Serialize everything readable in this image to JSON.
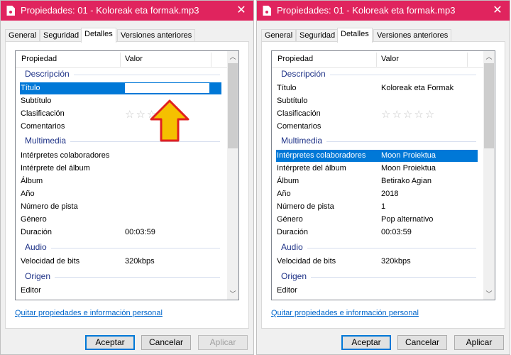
{
  "colors": {
    "titlebar": "#e0245e",
    "selection": "#0078d7",
    "group": "#1e3287",
    "link": "#0066cc",
    "arrow_fill": "#f5c000",
    "arrow_stroke": "#e02020"
  },
  "left": {
    "title": "Propiedades: 01 - Koloreak eta formak.mp3",
    "tabs": [
      "General",
      "Seguridad",
      "Detalles",
      "Versiones anteriores"
    ],
    "header": {
      "property": "Propiedad",
      "value": "Valor"
    },
    "groups": {
      "description": "Descripción",
      "multimedia": "Multimedia",
      "audio": "Audio",
      "origin": "Origen"
    },
    "rows": {
      "title": "Título",
      "subtitle": "Subtítulo",
      "rating": "Clasificación",
      "comments": "Comentarios",
      "contrib": "Intérpretes colaboradores",
      "album_artist": "Intérprete del álbum",
      "album": "Álbum",
      "year": "Año",
      "track": "Número de pista",
      "genre": "Género",
      "duration": "Duración",
      "duration_value": "00:03:59",
      "bitrate": "Velocidad de bits",
      "bitrate_value": "320kbps",
      "editor": "Editor"
    },
    "stars": "☆☆☆☆☆",
    "link": "Quitar propiedades e información personal",
    "buttons": {
      "ok": "Aceptar",
      "cancel": "Cancelar",
      "apply": "Aplicar"
    }
  },
  "right": {
    "title": "Propiedades: 01 - Koloreak eta formak.mp3",
    "tabs": [
      "General",
      "Seguridad",
      "Detalles",
      "Versiones anteriores"
    ],
    "header": {
      "property": "Propiedad",
      "value": "Valor"
    },
    "groups": {
      "description": "Descripción",
      "multimedia": "Multimedia",
      "audio": "Audio",
      "origin": "Origen"
    },
    "rows": {
      "title": "Título",
      "title_value": "Koloreak eta Formak",
      "subtitle": "Subtítulo",
      "rating": "Clasificación",
      "comments": "Comentarios",
      "contrib": "Intérpretes colaboradores",
      "contrib_value": "Moon Proiektua",
      "album_artist": "Intérprete del álbum",
      "album_artist_value": "Moon Proiektua",
      "album": "Álbum",
      "album_value": "Betirako Agian",
      "year": "Año",
      "year_value": "2018",
      "track": "Número de pista",
      "track_value": "1",
      "genre": "Género",
      "genre_value": "Pop alternativo",
      "duration": "Duración",
      "duration_value": "00:03:59",
      "bitrate": "Velocidad de bits",
      "bitrate_value": "320kbps",
      "editor": "Editor"
    },
    "stars": "☆☆☆☆☆",
    "link": "Quitar propiedades e información personal",
    "buttons": {
      "ok": "Aceptar",
      "cancel": "Cancelar",
      "apply": "Aplicar"
    }
  }
}
